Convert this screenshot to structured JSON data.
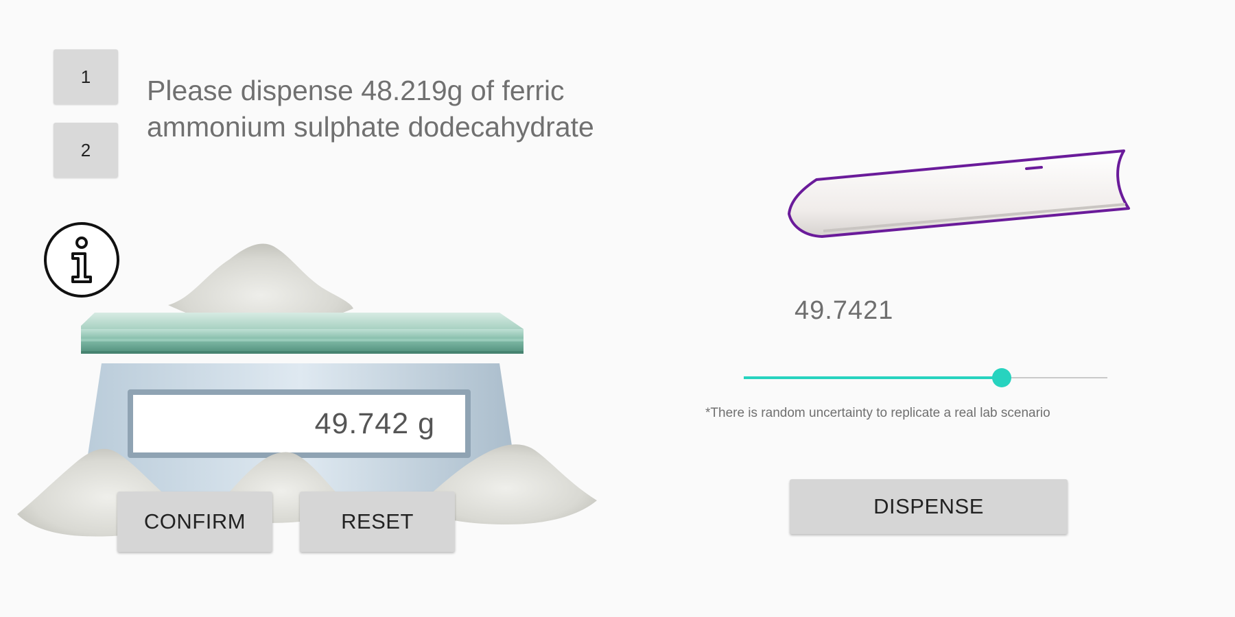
{
  "steps": [
    {
      "label": "1"
    },
    {
      "label": "2"
    }
  ],
  "instruction": {
    "line1": "Please dispense 48.219g of ferric",
    "line2": "ammonium sulphate dodecahydrate"
  },
  "scale": {
    "reading": "49.742",
    "unit": "g"
  },
  "buttons": {
    "confirm": "CONFIRM",
    "reset": "RESET",
    "dispense": "DISPENSE"
  },
  "dispenser": {
    "amount": "49.7421",
    "slider_fraction": 0.71,
    "note": "*There is random uncertainty to replicate a real lab scenario"
  },
  "icons": {
    "info": "info-icon",
    "spatula": "spatula-icon"
  },
  "colors": {
    "accent": "#27d3bf",
    "spatula_outline": "#6a1b9a",
    "button_bg": "#d6d6d6",
    "page_bg": "#fafafa"
  }
}
